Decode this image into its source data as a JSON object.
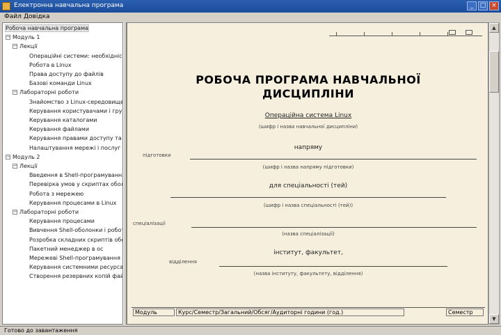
{
  "window": {
    "title": "Електронна навчальна програма",
    "minimize": "_",
    "maximize": "□",
    "close": "×"
  },
  "menu": [
    "Файл",
    "Довідка"
  ],
  "tree": [
    {
      "label": "Робоча навчальна програма",
      "level": 0,
      "expander": "",
      "selected": true
    },
    {
      "label": "Модуль 1",
      "level": 0,
      "expander": "−"
    },
    {
      "label": "Лекції",
      "level": 1,
      "expander": "−"
    },
    {
      "label": "Операційні системи: необхідність",
      "level": 2
    },
    {
      "label": "Робота в Linux",
      "level": 2
    },
    {
      "label": "Права доступу до файлів",
      "level": 2
    },
    {
      "label": "Базові команди Linux",
      "level": 2
    },
    {
      "label": "Лабораторні роботи",
      "level": 1,
      "expander": "−"
    },
    {
      "label": "Знайомство з Linux-середовищем",
      "level": 2
    },
    {
      "label": "Керування користувачами і груп",
      "level": 2
    },
    {
      "label": "Керування каталогами",
      "level": 2
    },
    {
      "label": "Керування файлами",
      "level": 2
    },
    {
      "label": "Керування правами доступу та влас",
      "level": 2
    },
    {
      "label": "Налаштування мережі і послуг д",
      "level": 2
    },
    {
      "label": "Модуль 2",
      "level": 0,
      "expander": "−"
    },
    {
      "label": "Лекції",
      "level": 1,
      "expander": "−"
    },
    {
      "label": "Введення в Shell-програмування",
      "level": 2
    },
    {
      "label": "Перевірка умов у скриптах оболонк",
      "level": 2
    },
    {
      "label": "Робота з мережею",
      "level": 2
    },
    {
      "label": "Керування процесами в Linux",
      "level": 2
    },
    {
      "label": "Лабораторні роботи",
      "level": 1,
      "expander": "−"
    },
    {
      "label": "Керування процесами",
      "level": 2
    },
    {
      "label": "Вивчення Shell-оболонки і роботи з",
      "level": 2
    },
    {
      "label": "Розробка складних скриптів оболонки",
      "level": 2
    },
    {
      "label": "Пакетний менеджер в ос",
      "level": 2
    },
    {
      "label": "Мережеві Shell-програмування",
      "level": 2
    },
    {
      "label": "Керування системними ресурсами",
      "level": 2
    },
    {
      "label": "Створення резервних копій файлів в с",
      "level": 2
    }
  ],
  "document": {
    "title_line1": "РОБОЧА ПРОГРАМА НАВЧАЛЬНОЇ",
    "title_line2": "ДИСЦИПЛІНИ",
    "discipline": "Операційна система Linux",
    "discipline_caption": "(шифр і назва навчальної дисципліни)",
    "direction_value": "напряму",
    "direction_label": "підготовки",
    "direction_caption": "(шифр і назва напряму підготовки)",
    "specialty_value": "для спеціальності (тей)",
    "specialty_caption": "(шифр і назва спеціальності (тей))",
    "specialization_label": "спеціалізації",
    "specialization_caption": "(назва спеціалізації)",
    "institute_value": "інститут, факультет,",
    "department_label": "відділення",
    "department_caption": "(назва інституту, факультету, відділення)",
    "footer_left": "Модуль",
    "footer_middle": "Курс/Семестр/Загальний/Обсяг/Аудиторні години (год.)",
    "footer_right": "Семестр"
  },
  "status": "Готово до завантаження"
}
